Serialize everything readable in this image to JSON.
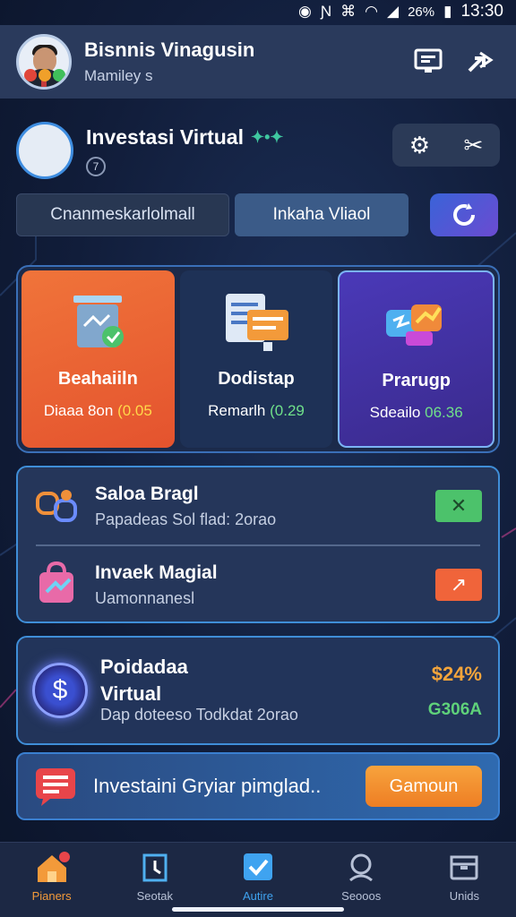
{
  "status_bar": {
    "battery": "26%",
    "time": "13:30"
  },
  "app_bar": {
    "title": "Bisnnis Vinagusin",
    "subtitle": "Mamiley s"
  },
  "profile": {
    "name": "Investasi Virtual",
    "badge": "7"
  },
  "tabs": [
    {
      "label": "Cnanmeskarlolmall"
    },
    {
      "label": "Inkaha Vliaol"
    }
  ],
  "cards": [
    {
      "title": "Beahaiiln",
      "label": "Diaaa 8on",
      "value": "(0.05"
    },
    {
      "title": "Dodistap",
      "label": "Remarlh",
      "value": "(0.29"
    },
    {
      "title": "Prarugp",
      "label": "Sdeailo",
      "value": "06.36"
    }
  ],
  "list": [
    {
      "title": "Saloa Bragl",
      "subtitle": "Papadeas Sol flad: 2orao"
    },
    {
      "title": "Invaek Magial",
      "subtitle": "Uamonnanesl"
    }
  ],
  "virtual": {
    "title": "Poidadaa Virtual",
    "subtitle": "Dap doteeso Todkdat 2orao",
    "value1": "$24%",
    "value2": "G306A"
  },
  "banner": {
    "text": "Investaini Gryiar pimglad..",
    "button": "Gamoun"
  },
  "nav": [
    {
      "label": "Pianers"
    },
    {
      "label": "Seotak"
    },
    {
      "label": "Autire"
    },
    {
      "label": "Seooos"
    },
    {
      "label": "Unids"
    }
  ],
  "colors": {
    "accent": "#3fa3f0",
    "orange": "#f0743a",
    "purple": "#4a39b8",
    "green": "#5fd17a",
    "gold": "#f5a53b"
  }
}
